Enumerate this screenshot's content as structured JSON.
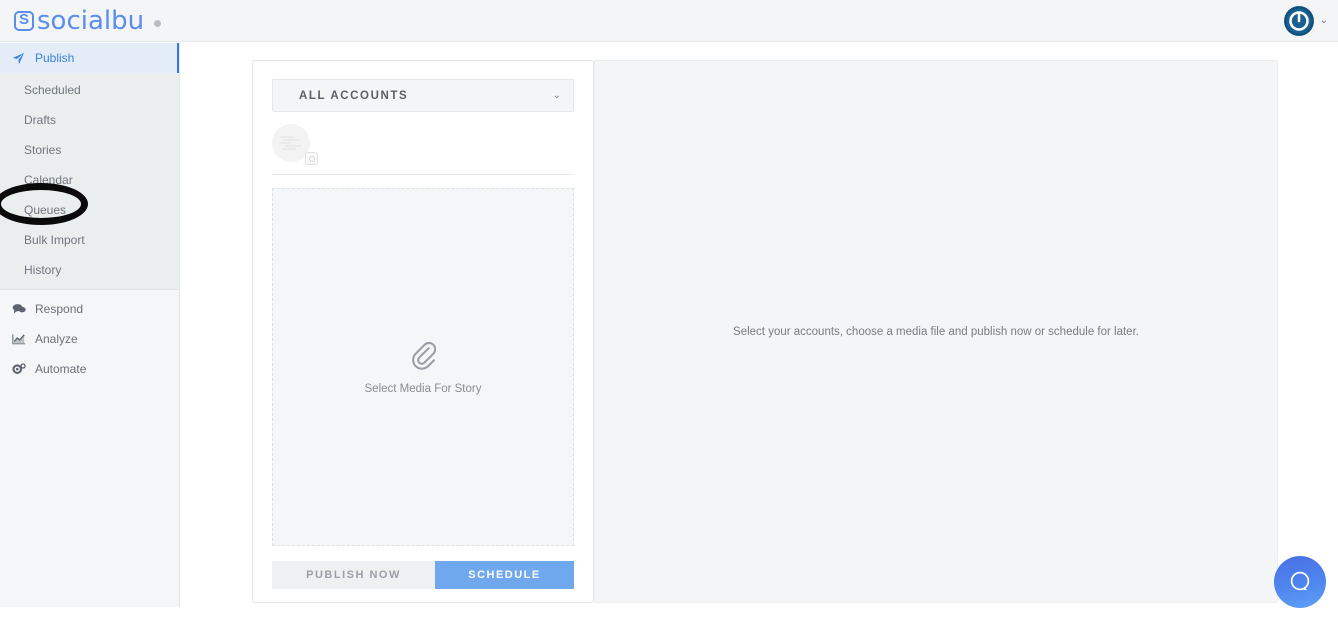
{
  "header": {
    "logo_text": "socialbu",
    "logo_mark_letter": "S",
    "status_dot": "status-dot",
    "user_avatar_name": "user-avatar",
    "user_caret": "⌄"
  },
  "sidebar": {
    "primary": [
      {
        "label": "Publish",
        "icon": "paper-plane-icon",
        "active": true
      }
    ],
    "sub_items": [
      {
        "label": "Scheduled"
      },
      {
        "label": "Drafts"
      },
      {
        "label": "Stories"
      },
      {
        "label": "Calendar"
      },
      {
        "label": "Queues"
      },
      {
        "label": "Bulk Import"
      },
      {
        "label": "History"
      }
    ],
    "lower": [
      {
        "label": "Respond",
        "icon": "chat-bubbles-icon"
      },
      {
        "label": "Analyze",
        "icon": "chart-line-icon"
      },
      {
        "label": "Automate",
        "icon": "gears-icon"
      }
    ],
    "annotation": "ellipse-highlight-stories"
  },
  "composer": {
    "accounts_select": {
      "label": "ALL ACCOUNTS",
      "caret": "⌄"
    },
    "account": {
      "avatar_name": "account-avatar",
      "network_badge": "instagram-icon"
    },
    "dropzone": {
      "icon": "paperclip-icon",
      "label": "Select Media For Story"
    },
    "buttons": {
      "publish_now": "PUBLISH NOW",
      "schedule": "SCHEDULE"
    }
  },
  "preview": {
    "hint": "Select your accounts, choose a media file and publish now or schedule for later."
  },
  "beacon": {
    "icon": "help-chat-icon"
  },
  "colors": {
    "brand_blue": "#5b8def",
    "active_nav_blue": "#3b82e0",
    "schedule_button": "#6fa8ec",
    "sidebar_bg": "#f4f6f7",
    "subnav_bg": "#eaeeee",
    "panel_bg": "#f4f5f7",
    "avatar_dark_blue": "#17608f",
    "annotation_black": "#0a0a0a"
  }
}
